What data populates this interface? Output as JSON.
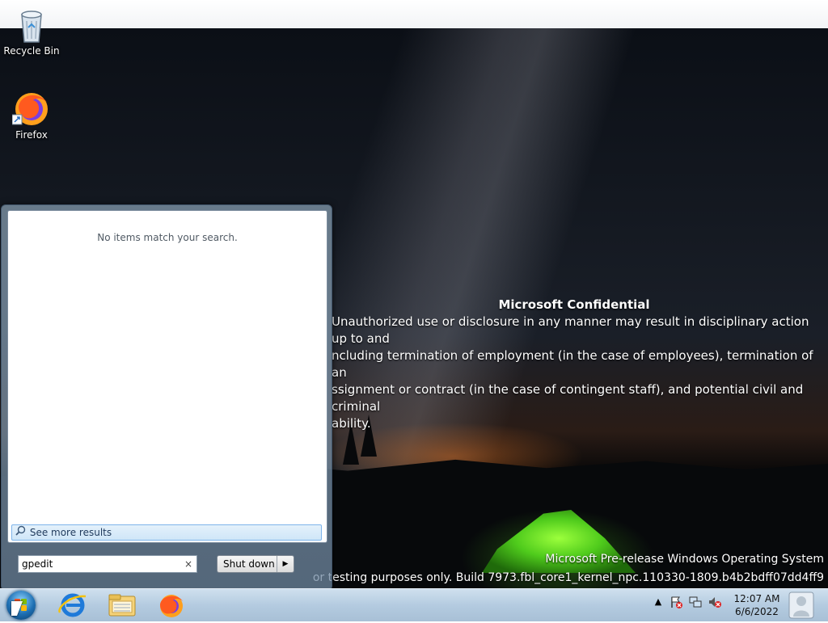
{
  "desktop": {
    "icons": [
      {
        "label": "Recycle Bin",
        "icon": "recycle-bin-icon"
      },
      {
        "label": "Firefox",
        "icon": "firefox-icon"
      }
    ],
    "confidential": {
      "heading": "Microsoft Confidential",
      "lines": [
        "Unauthorized use or disclosure in any manner may result in disciplinary action up to and",
        "ncluding termination of employment (in the case of employees), termination of an",
        "ssignment or contract (in the case of contingent staff), and potential civil and criminal",
        "ability."
      ]
    },
    "watermark": {
      "line1": "Microsoft Pre-release Windows Operating System",
      "line2": "or testing purposes only. Build 7973.fbl_core1_kernel_npc.110330-1809.b4b2bdff07dd4ff9"
    }
  },
  "start_menu": {
    "no_results": "No items match your search.",
    "see_more": "See more results",
    "search_value": "gpedit",
    "clear_glyph": "×",
    "shutdown_label": "Shut down",
    "shutdown_arrow": "▶"
  },
  "taskbar": {
    "pinned": [
      "internet-explorer-icon",
      "windows-explorer-icon",
      "firefox-icon"
    ],
    "tray": {
      "show_hidden": "▲",
      "clock_time": "12:07 AM",
      "clock_date": "6/6/2022"
    }
  },
  "colors": {
    "accent": "#1d6fb3",
    "selection": "#cfe6f8",
    "tent": "#4fcb1c"
  }
}
